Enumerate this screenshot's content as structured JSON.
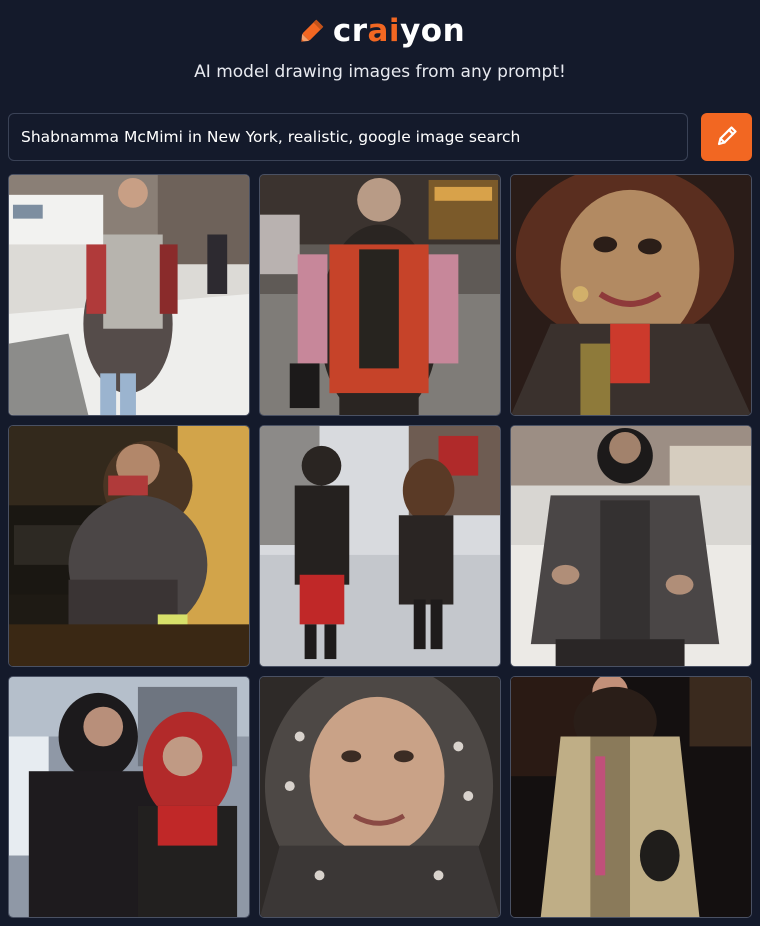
{
  "brand": {
    "name_prefix": "cr",
    "name_accent": "ai",
    "name_suffix": "yon",
    "accent_color": "#f26722",
    "logo_icon": "crayon-icon"
  },
  "tagline": "AI model drawing images from any prompt!",
  "prompt": {
    "value": "Shabnamma McMimi in New York, realistic, google image search",
    "draw_button_icon": "pencil-icon"
  },
  "results": [
    {
      "name": "result-image-1"
    },
    {
      "name": "result-image-2"
    },
    {
      "name": "result-image-3"
    },
    {
      "name": "result-image-4"
    },
    {
      "name": "result-image-5"
    },
    {
      "name": "result-image-6"
    },
    {
      "name": "result-image-7"
    },
    {
      "name": "result-image-8"
    },
    {
      "name": "result-image-9"
    }
  ],
  "colors": {
    "background": "#141a2b",
    "button": "#f26722"
  }
}
